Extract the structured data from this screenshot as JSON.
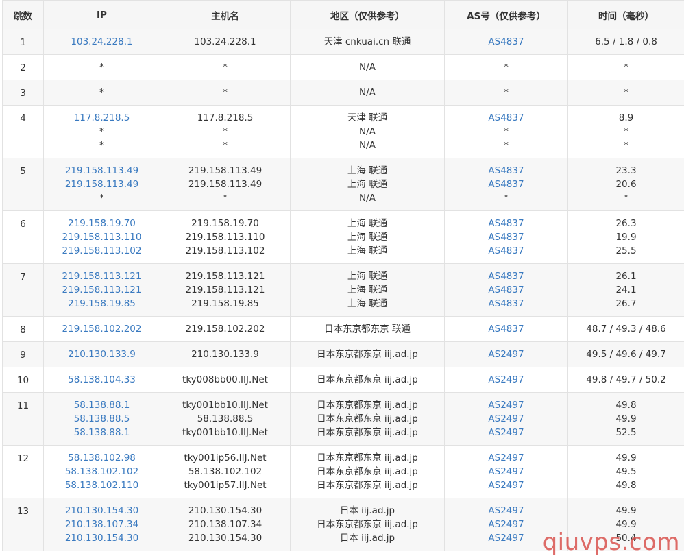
{
  "headers": [
    "跳数",
    "IP",
    "主机名",
    "地区（仅供参考）",
    "AS号（仅供参考）",
    "时间（毫秒）"
  ],
  "rows": [
    {
      "hop": "1",
      "ips": [
        "103.24.228.1"
      ],
      "hosts": [
        "103.24.228.1"
      ],
      "regions": [
        "天津 cnkuai.cn 联通"
      ],
      "asns": [
        "AS4837"
      ],
      "times": [
        "6.5 / 1.8 / 0.8"
      ]
    },
    {
      "hop": "2",
      "ips": [
        "*"
      ],
      "hosts": [
        "*"
      ],
      "regions": [
        "N/A"
      ],
      "asns": [
        "*"
      ],
      "times": [
        "*"
      ]
    },
    {
      "hop": "3",
      "ips": [
        "*"
      ],
      "hosts": [
        "*"
      ],
      "regions": [
        "N/A"
      ],
      "asns": [
        "*"
      ],
      "times": [
        "*"
      ]
    },
    {
      "hop": "4",
      "ips": [
        "117.8.218.5",
        "*",
        "*"
      ],
      "hosts": [
        "117.8.218.5",
        "*",
        "*"
      ],
      "regions": [
        "天津 联通",
        "N/A",
        "N/A"
      ],
      "asns": [
        "AS4837",
        "*",
        "*"
      ],
      "times": [
        "8.9",
        "*",
        "*"
      ]
    },
    {
      "hop": "5",
      "ips": [
        "219.158.113.49",
        "219.158.113.49",
        "*"
      ],
      "hosts": [
        "219.158.113.49",
        "219.158.113.49",
        "*"
      ],
      "regions": [
        "上海 联通",
        "上海 联通",
        "N/A"
      ],
      "asns": [
        "AS4837",
        "AS4837",
        "*"
      ],
      "times": [
        "23.3",
        "20.6",
        "*"
      ]
    },
    {
      "hop": "6",
      "ips": [
        "219.158.19.70",
        "219.158.113.110",
        "219.158.113.102"
      ],
      "hosts": [
        "219.158.19.70",
        "219.158.113.110",
        "219.158.113.102"
      ],
      "regions": [
        "上海 联通",
        "上海 联通",
        "上海 联通"
      ],
      "asns": [
        "AS4837",
        "AS4837",
        "AS4837"
      ],
      "times": [
        "26.3",
        "19.9",
        "25.5"
      ]
    },
    {
      "hop": "7",
      "ips": [
        "219.158.113.121",
        "219.158.113.121",
        "219.158.19.85"
      ],
      "hosts": [
        "219.158.113.121",
        "219.158.113.121",
        "219.158.19.85"
      ],
      "regions": [
        "上海 联通",
        "上海 联通",
        "上海 联通"
      ],
      "asns": [
        "AS4837",
        "AS4837",
        "AS4837"
      ],
      "times": [
        "26.1",
        "24.1",
        "26.7"
      ]
    },
    {
      "hop": "8",
      "ips": [
        "219.158.102.202"
      ],
      "hosts": [
        "219.158.102.202"
      ],
      "regions": [
        "日本东京都东京 联通"
      ],
      "asns": [
        "AS4837"
      ],
      "times": [
        "48.7 / 49.3 / 48.6"
      ]
    },
    {
      "hop": "9",
      "ips": [
        "210.130.133.9"
      ],
      "hosts": [
        "210.130.133.9"
      ],
      "regions": [
        "日本东京都东京 iij.ad.jp"
      ],
      "asns": [
        "AS2497"
      ],
      "times": [
        "49.5 / 49.6 / 49.7"
      ]
    },
    {
      "hop": "10",
      "ips": [
        "58.138.104.33"
      ],
      "hosts": [
        "tky008bb00.IIJ.Net"
      ],
      "regions": [
        "日本东京都东京 iij.ad.jp"
      ],
      "asns": [
        "AS2497"
      ],
      "times": [
        "49.8 / 49.7 / 50.2"
      ]
    },
    {
      "hop": "11",
      "ips": [
        "58.138.88.1",
        "58.138.88.5",
        "58.138.88.1"
      ],
      "hosts": [
        "tky001bb10.IIJ.Net",
        "58.138.88.5",
        "tky001bb10.IIJ.Net"
      ],
      "regions": [
        "日本东京都东京 iij.ad.jp",
        "日本东京都东京 iij.ad.jp",
        "日本东京都东京 iij.ad.jp"
      ],
      "asns": [
        "AS2497",
        "AS2497",
        "AS2497"
      ],
      "times": [
        "49.8",
        "49.9",
        "52.5"
      ]
    },
    {
      "hop": "12",
      "ips": [
        "58.138.102.98",
        "58.138.102.102",
        "58.138.102.110"
      ],
      "hosts": [
        "tky001ip56.IIJ.Net",
        "58.138.102.102",
        "tky001ip57.IIJ.Net"
      ],
      "regions": [
        "日本东京都东京 iij.ad.jp",
        "日本东京都东京 iij.ad.jp",
        "日本东京都东京 iij.ad.jp"
      ],
      "asns": [
        "AS2497",
        "AS2497",
        "AS2497"
      ],
      "times": [
        "49.9",
        "49.5",
        "49.8"
      ]
    },
    {
      "hop": "13",
      "ips": [
        "210.130.154.30",
        "210.138.107.34",
        "210.130.154.30"
      ],
      "hosts": [
        "210.130.154.30",
        "210.138.107.34",
        "210.130.154.30"
      ],
      "regions": [
        "日本 iij.ad.jp",
        "日本东京都东京 iij.ad.jp",
        "日本 iij.ad.jp"
      ],
      "asns": [
        "AS2497",
        "AS2497",
        "AS2497"
      ],
      "times": [
        "49.9",
        "49.9",
        "50.4"
      ]
    }
  ],
  "watermark": "qiuvps.com",
  "colors": {
    "link": "#3a7ac0",
    "header_bg": "#f6f6f6",
    "row_stripe": "#f7f7f7",
    "border": "#e2e2e2",
    "watermark": "#d9534f"
  }
}
